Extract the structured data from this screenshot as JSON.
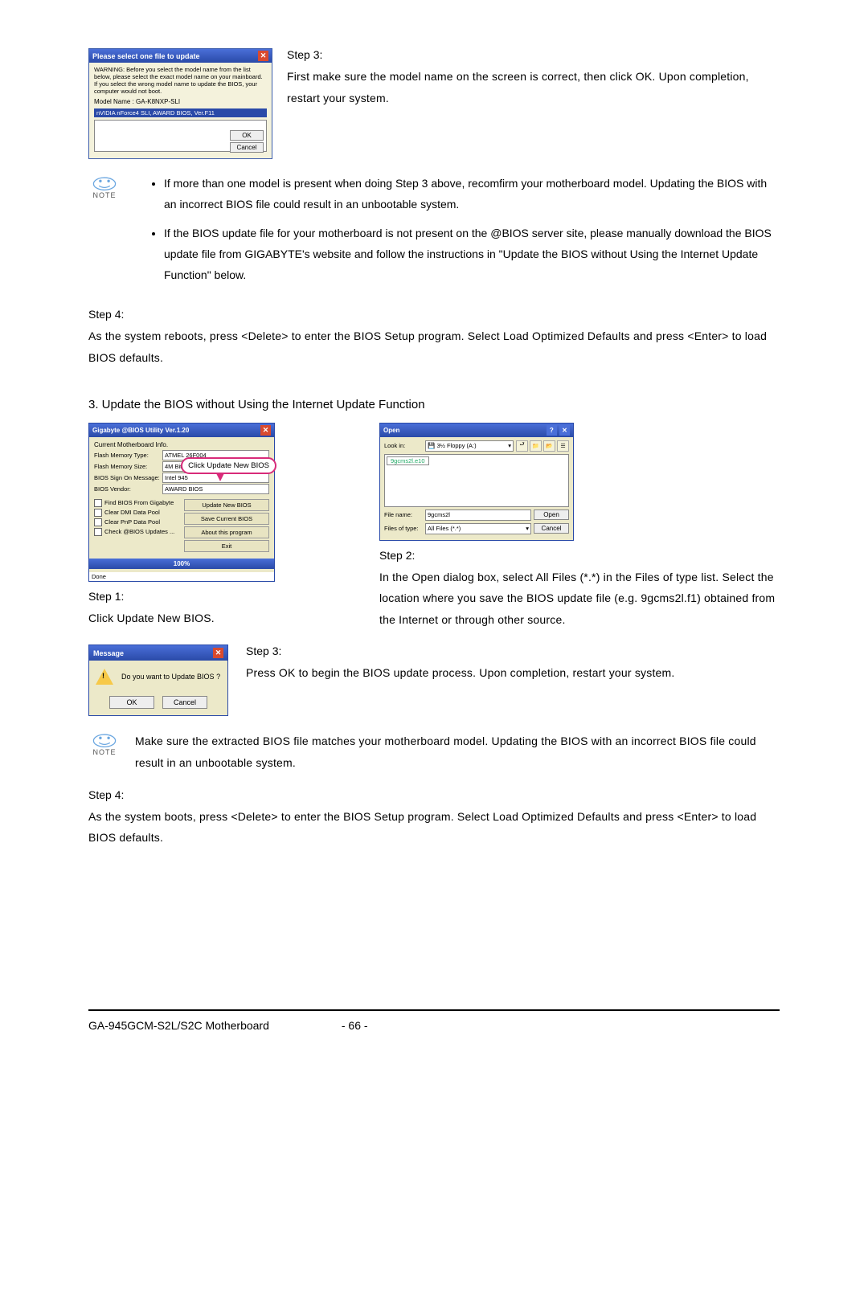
{
  "dialog1": {
    "title": "Please select one file to update",
    "warning": "WARNING: Before you select the model name from the list below, please select the exact model name on your mainboard. If you select the wrong model name to update the BIOS, your computer would not boot.",
    "model_label": "Model Name : GA-K8NXP-SLI",
    "selected": "nVIDIA nForce4 SLI, AWARD BIOS, Ver.F11",
    "ok": "OK",
    "cancel": "Cancel"
  },
  "top_step3_label": "Step 3:",
  "top_step3_text": "First make sure the model name on the screen is correct, then click OK. Upon completion, restart your system.",
  "note_label": "NOTE",
  "note1_bullets": [
    "If more than one model is present when doing Step 3 above, recomfirm your motherboard model. Updating the BIOS with an incorrect BIOS file could result in an unbootable system.",
    "If the BIOS update file for your motherboard is not present on the @BIOS server site, please manually download the BIOS update file from GIGABYTE's website and follow the instructions in \"Update the BIOS without Using the Internet Update Function\" below."
  ],
  "top_step4_label": "Step 4:",
  "top_step4_text": "As the system reboots, press <Delete> to enter the BIOS Setup program. Select Load Optimized Defaults and press <Enter> to load BIOS defaults.",
  "section_heading": "3.  Update the BIOS without Using the Internet Update Function",
  "util": {
    "title": "Gigabyte @BIOS Utility Ver.1.20",
    "info_label": "Current Motherboard Info.",
    "rows": [
      {
        "l": "Flash Memory Type:",
        "v": "ATMEL 26F004"
      },
      {
        "l": "Flash Memory Size:",
        "v": "4M Bits (F)"
      },
      {
        "l": "BIOS Sign On Message:",
        "v": "Intel 945"
      },
      {
        "l": "BIOS Vendor:",
        "v": "AWARD BIOS"
      }
    ],
    "checks": [
      "Find BIOS From Gigabyte",
      "Clear DMI Data Pool",
      "Clear PnP Data Pool",
      "Check @BIOS Updates ..."
    ],
    "buttons": [
      "Update New BIOS",
      "Save Current BIOS",
      "About this program",
      "Exit"
    ],
    "progress": "100%",
    "done": "Done",
    "callout": "Click Update New BIOS"
  },
  "step1_label": "Step 1:",
  "step1_text": "Click Update New BIOS.",
  "opendlg": {
    "title": "Open",
    "lookin_label": "Look in:",
    "lookin_value": "3½ Floppy (A:)",
    "file_item": "9gcms2l.e10",
    "filename_label": "File name:",
    "filename_value": "9gcms2l",
    "filetype_label": "Files of type:",
    "filetype_value": "All Files (*.*)",
    "open_btn": "Open",
    "cancel_btn": "Cancel"
  },
  "step2_label": "Step 2:",
  "step2_text": "In the Open dialog box, select All Files (*.*) in the Files of type list. Select the location where you save the BIOS update file (e.g. 9gcms2l.f1) obtained from the Internet or through other source.",
  "msgbox": {
    "title": "Message",
    "text": "Do you want to Update BIOS ?",
    "ok": "OK",
    "cancel": "Cancel"
  },
  "mid_step3_label": "Step 3:",
  "mid_step3_text": "Press OK to begin the BIOS update process. Upon completion, restart your system.",
  "note2_text": "Make sure the extracted BIOS file matches your motherboard model. Updating the BIOS with an incorrect BIOS file could result in an unbootable system.",
  "bottom_step4_label": "Step 4:",
  "bottom_step4_text": "As the system boots, press <Delete> to enter the BIOS Setup program. Select Load Optimized Defaults and press <Enter> to load BIOS defaults.",
  "footer_model": "GA-945GCM-S2L/S2C Motherboard",
  "footer_page": "- 66 -"
}
